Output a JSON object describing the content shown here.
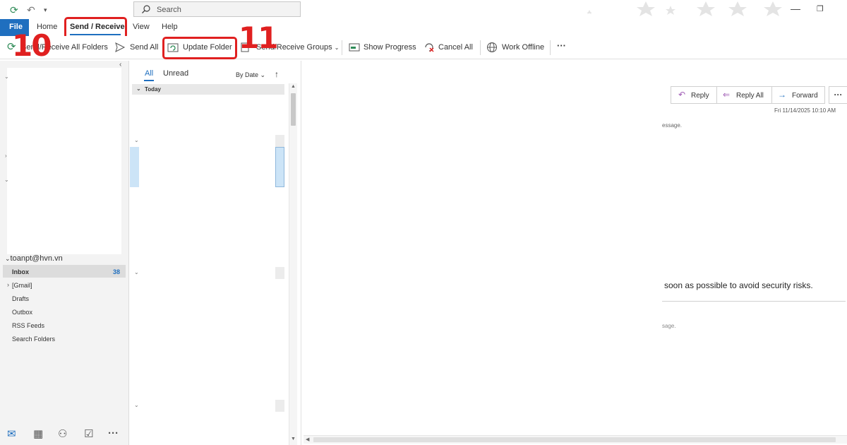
{
  "titlebar": {
    "search_placeholder": "Search"
  },
  "tabs": {
    "file": "File",
    "home": "Home",
    "send_receive": "Send / Receive",
    "view": "View",
    "help": "Help"
  },
  "ribbon": {
    "send_receive_all": "Send/Receive All Folders",
    "send_all": "Send All",
    "update_folder": "Update Folder",
    "send_receive_groups": "Send/Receive Groups",
    "show_progress": "Show Progress",
    "cancel_all": "Cancel All",
    "work_offline": "Work Offline",
    "more": "···"
  },
  "annotations": {
    "step_10": "10",
    "step_11": "11",
    "highlight_color": "#e02020"
  },
  "folders": {
    "account": "toanpt@hvn.vn",
    "items": [
      {
        "label": "Inbox",
        "count": "38"
      },
      {
        "label": "[Gmail]"
      },
      {
        "label": "Drafts"
      },
      {
        "label": "Outbox"
      },
      {
        "label": "RSS Feeds"
      },
      {
        "label": "Search Folders"
      }
    ]
  },
  "message_list": {
    "tab_all": "All",
    "tab_unread": "Unread",
    "sort": "By Date",
    "group": "Today"
  },
  "reading_pane": {
    "reply": "Reply",
    "reply_all": "Reply All",
    "forward": "Forward",
    "more": "···",
    "date": "Fri 11/14/2025 10:10 AM",
    "snippet1": "essage.",
    "body": "soon as possible to avoid security risks.",
    "snippet2": "sage."
  },
  "colors": {
    "accent": "#1f6fbf",
    "annotation": "#e02020"
  }
}
